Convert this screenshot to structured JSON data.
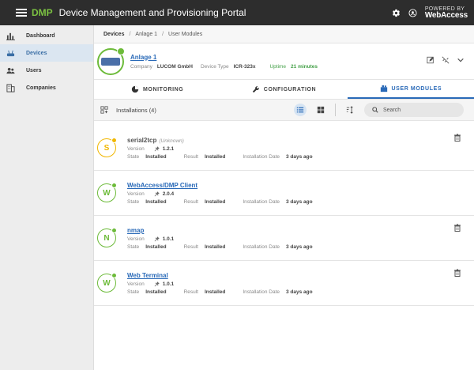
{
  "app": {
    "brand": "DMP",
    "title": "Device Management and Provisioning Portal",
    "powered_by": "POWERED BY",
    "powered_brand": "WebAccess"
  },
  "sidebar": {
    "items": [
      {
        "label": "Dashboard",
        "icon": "bar-chart-icon",
        "active": false
      },
      {
        "label": "Devices",
        "icon": "router-icon",
        "active": true
      },
      {
        "label": "Users",
        "icon": "users-icon",
        "active": false
      },
      {
        "label": "Companies",
        "icon": "building-icon",
        "active": false
      }
    ]
  },
  "breadcrumb": [
    "Devices",
    "Anlage 1",
    "User Modules"
  ],
  "device": {
    "name": "Anlage 1",
    "company_label": "Company",
    "company": "LUCOM GmbH",
    "type_label": "Device Type",
    "type": "ICR-323x",
    "uptime_label": "Uptime",
    "uptime": "21 minutes"
  },
  "tabs": [
    {
      "label": "MONITORING",
      "icon": "pie-chart-icon",
      "active": false
    },
    {
      "label": "CONFIGURATION",
      "icon": "wrench-icon",
      "active": false
    },
    {
      "label": "USER MODULES",
      "icon": "modules-icon",
      "active": true
    }
  ],
  "toolbar": {
    "installations": "Installations (4)",
    "search_placeholder": "Search"
  },
  "module_labels": {
    "version": "Version",
    "state": "State",
    "result": "Result",
    "date": "Installation Date"
  },
  "modules": [
    {
      "name": "serial2tcp",
      "note": "(Unknown)",
      "letter": "S",
      "version": "1.2.1",
      "state": "Installed",
      "result": "Installed",
      "date": "3 days ago",
      "status": "warn",
      "link": false,
      "deletable": true
    },
    {
      "name": "WebAccess/DMP Client",
      "note": "",
      "letter": "W",
      "version": "2.0.4",
      "state": "Installed",
      "result": "Installed",
      "date": "3 days ago",
      "status": "ok",
      "link": true,
      "deletable": false
    },
    {
      "name": "nmap",
      "note": "",
      "letter": "N",
      "version": "1.0.1",
      "state": "Installed",
      "result": "Installed",
      "date": "3 days ago",
      "status": "ok",
      "link": true,
      "deletable": true
    },
    {
      "name": "Web Terminal",
      "note": "",
      "letter": "W",
      "version": "1.0.1",
      "state": "Installed",
      "result": "Installed",
      "date": "3 days ago",
      "status": "ok",
      "link": true,
      "deletable": true
    }
  ],
  "colors": {
    "accent_green": "#7cc242",
    "ok_green": "#6dbb3a",
    "warn_yellow": "#f1b700",
    "link_blue": "#2a6ab8",
    "topbar": "#2d2d2d"
  }
}
